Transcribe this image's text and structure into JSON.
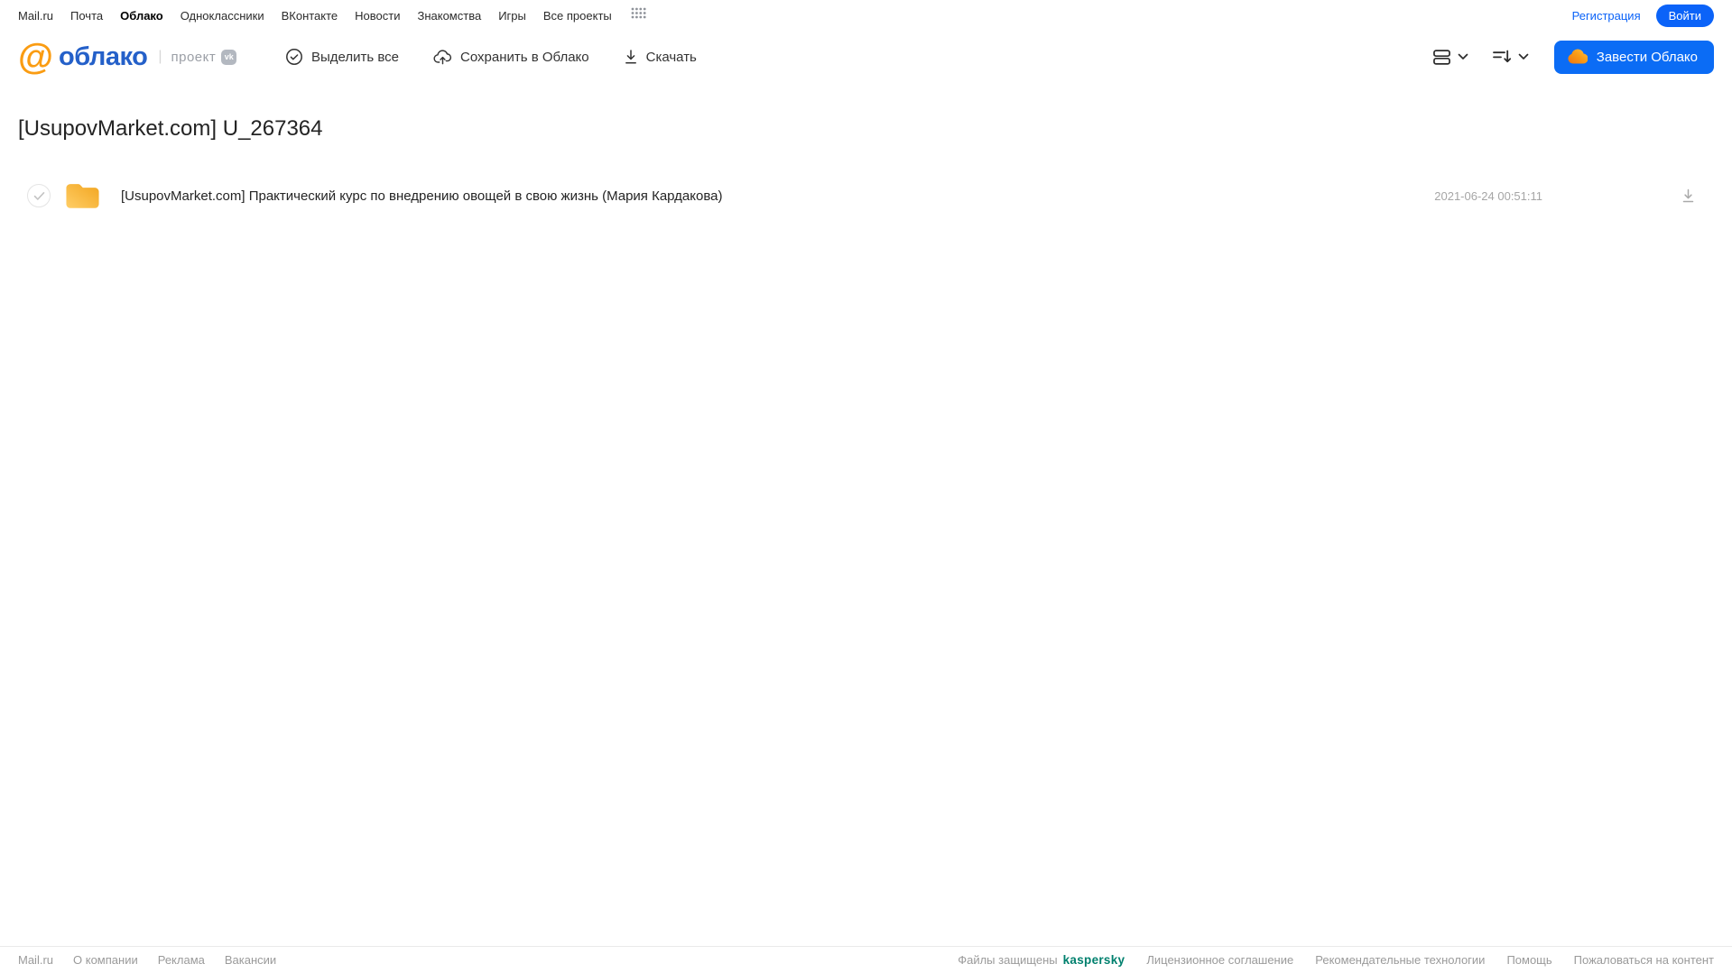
{
  "top_nav": {
    "items": [
      "Mail.ru",
      "Почта",
      "Облако",
      "Одноклассники",
      "ВКонтакте",
      "Новости",
      "Знакомства",
      "Игры",
      "Все проекты"
    ],
    "registration_label": "Регистрация",
    "login_label": "Войти"
  },
  "header": {
    "logo_at": "@",
    "logo_text": "облако",
    "project_label": "проект",
    "vk_badge_label": "vk",
    "toolbar": {
      "select_all_label": "Выделить все",
      "save_to_cloud_label": "Сохранить в Облако",
      "download_label": "Скачать"
    },
    "get_cloud_label": "Завести Облако"
  },
  "main": {
    "title": "[UsupovMarket.com] U_267364",
    "files": [
      {
        "type": "folder",
        "name": "[UsupovMarket.com] Практический курс по внедрению овощей в свою жизнь (Мария Кардакова)",
        "date": "2021-06-24 00:51:11"
      }
    ]
  },
  "footer": {
    "left_links": [
      "Mail.ru",
      "О компании",
      "Реклама",
      "Вакансии"
    ],
    "protected_label": "Файлы защищены",
    "kaspersky_label": "kaspersky",
    "right_links": [
      "Лицензионное соглашение",
      "Рекомендательные технологии",
      "Помощь",
      "Пожаловаться на контент"
    ]
  },
  "icons": {
    "all_projects": "grid-dots-icon",
    "select_all": "check-circle-icon",
    "save_to_cloud": "cloud-upload-icon",
    "download": "download-icon",
    "view_mode": "rows-view-icon",
    "sort": "sort-desc-icon",
    "cloud_brand": "cloud-icon",
    "file": "folder-icon"
  },
  "colors": {
    "accent_blue": "#0b6cf5",
    "logo_blue": "#2460c9",
    "logo_orange": "#fa9c12",
    "folder_yellow_top": "#f2a727",
    "folder_yellow_bottom": "#ffce67",
    "kaspersky_green": "#00806e",
    "muted_gray": "#9a9a9a"
  }
}
